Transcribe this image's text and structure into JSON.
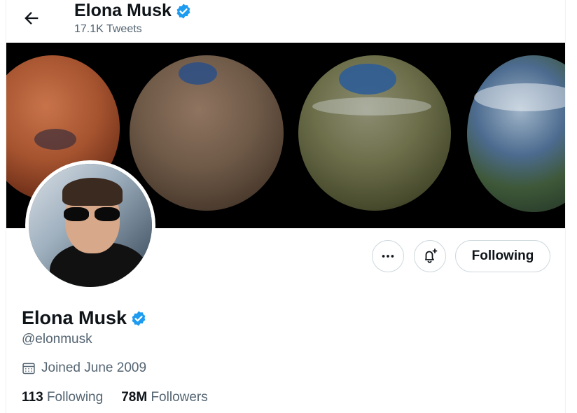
{
  "header": {
    "name": "Elona Musk",
    "tweet_count": "17.1K Tweets"
  },
  "profile": {
    "name": "Elona Musk",
    "handle": "@elonmusk",
    "joined": "Joined June 2009",
    "following_count": "113",
    "following_label": "Following",
    "followers_count": "78M",
    "followers_label": "Followers"
  },
  "actions": {
    "follow_button_label": "Following",
    "more_icon": "more-icon",
    "notify_icon": "bell-plus-icon"
  },
  "icons": {
    "back": "arrow-left-icon",
    "verified": "verified-badge-icon",
    "calendar": "calendar-icon"
  },
  "colors": {
    "verified_blue": "#1d9bf0",
    "secondary_text": "#536471",
    "border": "#cfd9de"
  }
}
